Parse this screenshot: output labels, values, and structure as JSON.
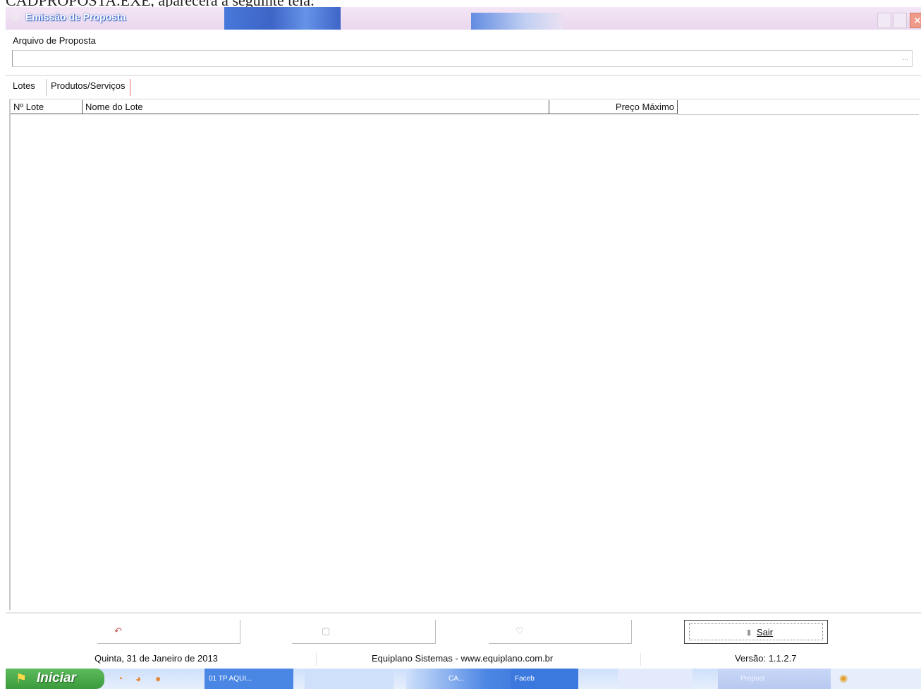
{
  "document": {
    "caption": "CADPROPOSTA.EXE, aparecerá a seguinte tela:"
  },
  "window": {
    "title": "Emissão de Proposta",
    "close_glyph": "✕"
  },
  "file": {
    "label": "Arquivo de Proposta",
    "value": "",
    "browse_label": "..."
  },
  "tabs": [
    {
      "label": "Lotes",
      "active": true
    },
    {
      "label": "Produtos/Serviços",
      "active": false
    }
  ],
  "grid": {
    "columns": [
      "Nº Lote",
      "Nome do Lote",
      "Preço Máximo"
    ],
    "rows": []
  },
  "actions": {
    "sair_label": "Sair"
  },
  "status": {
    "date": "Quinta, 31 de Janeiro de 2013",
    "company": "Equiplano Sistemas - www.equiplano.com.br",
    "version": "Versão: 1.1.2.7"
  },
  "taskbar": {
    "start_label": "Iniciar",
    "tasks": [
      "01 TP AQUI...",
      "",
      "CA...",
      "Faceb",
      "",
      "Propost"
    ]
  },
  "colors": {
    "title_blue": "#2a66d6",
    "start_green": "#3b9a3b",
    "close_red": "#ef9a8a"
  },
  "icons": [
    "app-icon",
    "browse-icon",
    "exit-icon",
    "start-flag-icon"
  ]
}
